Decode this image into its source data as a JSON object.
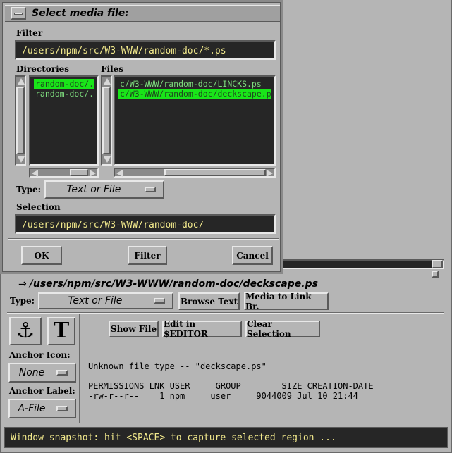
{
  "dialog": {
    "title": "Select media file:",
    "filter_label": "Filter",
    "filter_value": "/users/npm/src/W3-WWW/random-doc/*.ps",
    "directories_label": "Directories",
    "files_label": "Files",
    "directories": [
      {
        "text": "random-doc/.",
        "selected": true
      },
      {
        "text": "random-doc/..",
        "selected": false
      }
    ],
    "files": [
      {
        "text": "c/W3-WWW/random-doc/LINCKS.ps",
        "selected": false
      },
      {
        "text": "c/W3-WWW/random-doc/deckscape.ps",
        "selected": true
      }
    ],
    "type_label": "Type:",
    "type_value": "Text or File",
    "selection_label": "Selection",
    "selection_value": "/users/npm/src/W3-WWW/random-doc/",
    "ok_label": "OK",
    "filter_button_label": "Filter",
    "cancel_label": "Cancel"
  },
  "main": {
    "path_prefix": "⇒",
    "path": "/users/npm/src/W3-WWW/random-doc/deckscape.ps",
    "type_label": "Type:",
    "type_value": "Text or File",
    "browse_text_label": "Browse Text",
    "media_link_label": "Media to Link Br.",
    "show_file_label": "Show File",
    "edit_label": "Edit in $EDITOR",
    "clear_selection_label": "Clear Selection",
    "anchor_icon_label": "Anchor Icon:",
    "anchor_icon_value": "None",
    "anchor_label_label": "Anchor Label:",
    "anchor_label_value": "A-File",
    "text_icon_glyph": "T",
    "anchor_glyph": "⚓",
    "output_line1": "Unknown file type -- \"deckscape.ps\"",
    "output_header": "PERMISSIONS LNK USER     GROUP        SIZE CREATION-DATE",
    "output_row": "-rw-r--r--    1 npm     user     9044009 Jul 10 21:44"
  },
  "status": {
    "message": "Window snapshot: hit <SPACE> to capture selected region ..."
  },
  "colors": {
    "background": "#b5b5b5",
    "field_bg": "#262626",
    "field_text": "#f2e98c",
    "list_text": "#7cd97c",
    "list_selected": "#19e519",
    "status_text": "#f2e98c"
  }
}
